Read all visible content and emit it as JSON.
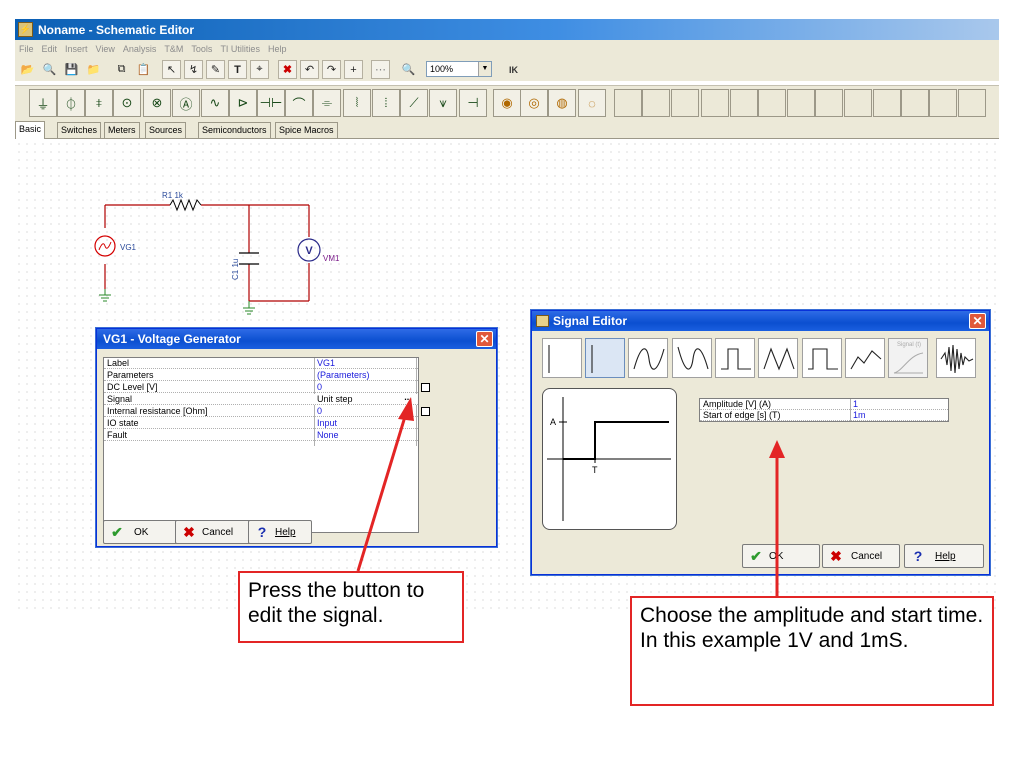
{
  "window": {
    "title": "Noname - Schematic Editor"
  },
  "menu": [
    "File",
    "Edit",
    "Insert",
    "View",
    "Analysis",
    "T&M",
    "Tools",
    "TI Utilities",
    "Help"
  ],
  "toolbar": {
    "zoom": "100%"
  },
  "component_tabs": [
    "Basic",
    "Switches",
    "Meters",
    "Sources",
    "Semiconductors",
    "Spice Macros"
  ],
  "schematic": {
    "r1_label": "R1 1k",
    "vg1_label": "VG1",
    "c1_label": "C1 1u",
    "vm1_label": "VM1",
    "vm_symbol": "V"
  },
  "vg1_dialog": {
    "title": "VG1 - Voltage Generator",
    "rows": [
      {
        "label": "Label",
        "value": "VG1"
      },
      {
        "label": "Parameters",
        "value": "(Parameters)"
      },
      {
        "label": "DC Level [V]",
        "value": "0"
      },
      {
        "label": "Signal",
        "value": "Unit step"
      },
      {
        "label": "Internal resistance [Ohm]",
        "value": "0"
      },
      {
        "label": "IO state",
        "value": "Input"
      },
      {
        "label": "Fault",
        "value": "None"
      }
    ],
    "ellipsis": "...",
    "ok": "OK",
    "cancel": "Cancel",
    "help": "Help"
  },
  "signal_editor": {
    "title": "Signal Editor",
    "signal_tiles": [
      "Signal (t)"
    ],
    "preview": {
      "a_label": "A",
      "t_label": "T"
    },
    "rows": [
      {
        "label": "Amplitude [V] (A)",
        "value": "1"
      },
      {
        "label": "Start of edge [s] (T)",
        "value": "1m"
      }
    ],
    "ok": "OK",
    "cancel": "Cancel",
    "help": "Help"
  },
  "callouts": {
    "left": "Press the button to edit the signal.",
    "right": "Choose the amplitude and start time.  In this example 1V and 1mS."
  },
  "colors": {
    "accent_red": "#e32525",
    "title_blue": "#0b4fd0",
    "value_blue": "#1a1adb"
  }
}
